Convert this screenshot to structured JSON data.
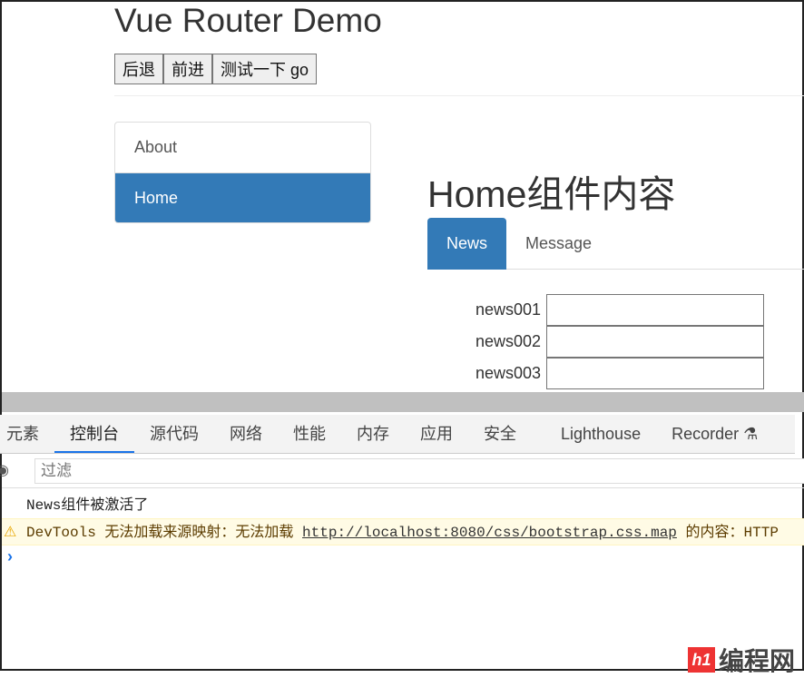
{
  "app": {
    "title": "Vue Router Demo",
    "buttons": [
      "后退",
      "前进",
      "测试一下 go"
    ]
  },
  "sidebar": {
    "items": [
      {
        "label": "About",
        "active": false
      },
      {
        "label": "Home",
        "active": true
      }
    ]
  },
  "main": {
    "title": "Home组件内容",
    "tabs": [
      {
        "label": "News",
        "active": true
      },
      {
        "label": "Message",
        "active": false
      }
    ],
    "news": [
      "news001",
      "news002",
      "news003"
    ]
  },
  "devtools": {
    "tabs": [
      "元素",
      "控制台",
      "源代码",
      "网络",
      "性能",
      "内存",
      "应用",
      "安全",
      "Lighthouse",
      "Recorder"
    ],
    "active_tab": "控制台",
    "filter_placeholder": "过滤",
    "logs": {
      "info": "News组件被激活了",
      "warn_prefix": "DevTools 无法加载来源映射：无法加载 ",
      "warn_link": "http://localhost:8080/css/bootstrap.css.map",
      "warn_suffix": " 的内容：HTTP"
    },
    "prompt": "›"
  },
  "watermark": {
    "mark": "h1",
    "text": "编程网"
  },
  "colors": {
    "primary": "#337ab7",
    "warn_bg": "#fffbe5",
    "active_tab_underline": "#1a73e8"
  }
}
